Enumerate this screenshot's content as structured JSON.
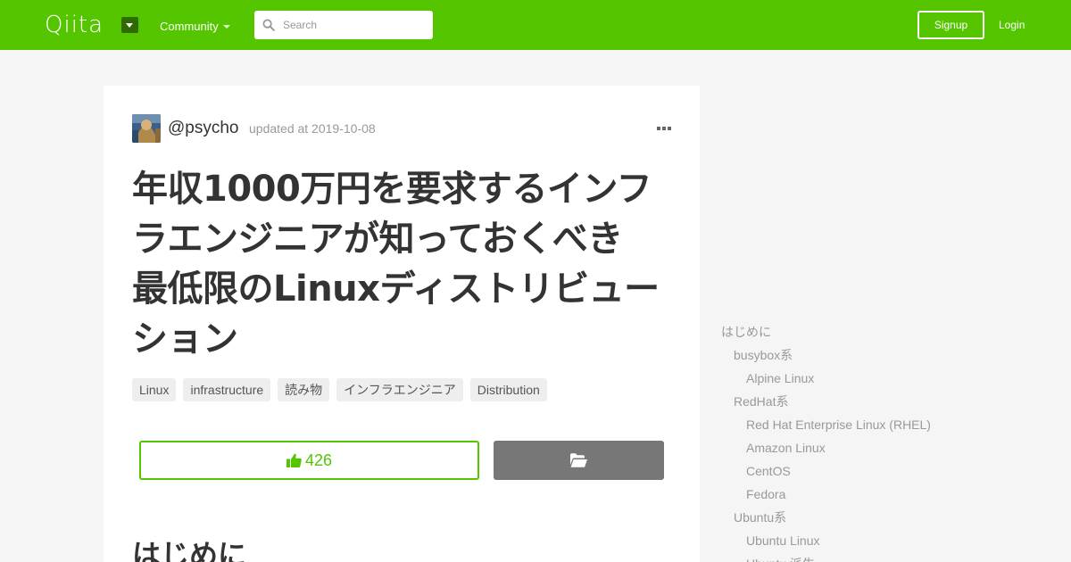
{
  "header": {
    "logo_text": "Qiita",
    "community_label": "Community",
    "search_placeholder": "Search",
    "signup_label": "Signup",
    "login_label": "Login",
    "brand_color": "#55c500"
  },
  "article": {
    "author": "@psycho",
    "updated": "updated at 2019-10-08",
    "title_lines": [
      "年収1000万円を要求するインフ",
      "ラエンジニアが知っておくべき",
      "最低限のLinuxディストリビュー",
      "ション"
    ],
    "tags": [
      "Linux",
      "infrastructure",
      "読み物",
      "インフラエンジニア",
      "Distribution"
    ],
    "like_count": "426",
    "first_heading": "はじめに"
  },
  "toc": {
    "items": [
      {
        "label": "はじめに",
        "level": 0
      },
      {
        "label": "busybox系",
        "level": 1
      },
      {
        "label": "Alpine Linux",
        "level": 2
      },
      {
        "label": "RedHat系",
        "level": 1
      },
      {
        "label": "Red Hat Enterprise Linux (RHEL)",
        "level": 2
      },
      {
        "label": "Amazon Linux",
        "level": 2
      },
      {
        "label": "CentOS",
        "level": 2
      },
      {
        "label": "Fedora",
        "level": 2
      },
      {
        "label": "Ubuntu系",
        "level": 1
      },
      {
        "label": "Ubuntu Linux",
        "level": 2
      },
      {
        "label": "Ubuntu 派生",
        "level": 2
      }
    ]
  },
  "icons": {
    "search": "search-icon",
    "more": "more-icon",
    "like": "thumbs-up-icon",
    "stock": "folder-open-icon"
  }
}
